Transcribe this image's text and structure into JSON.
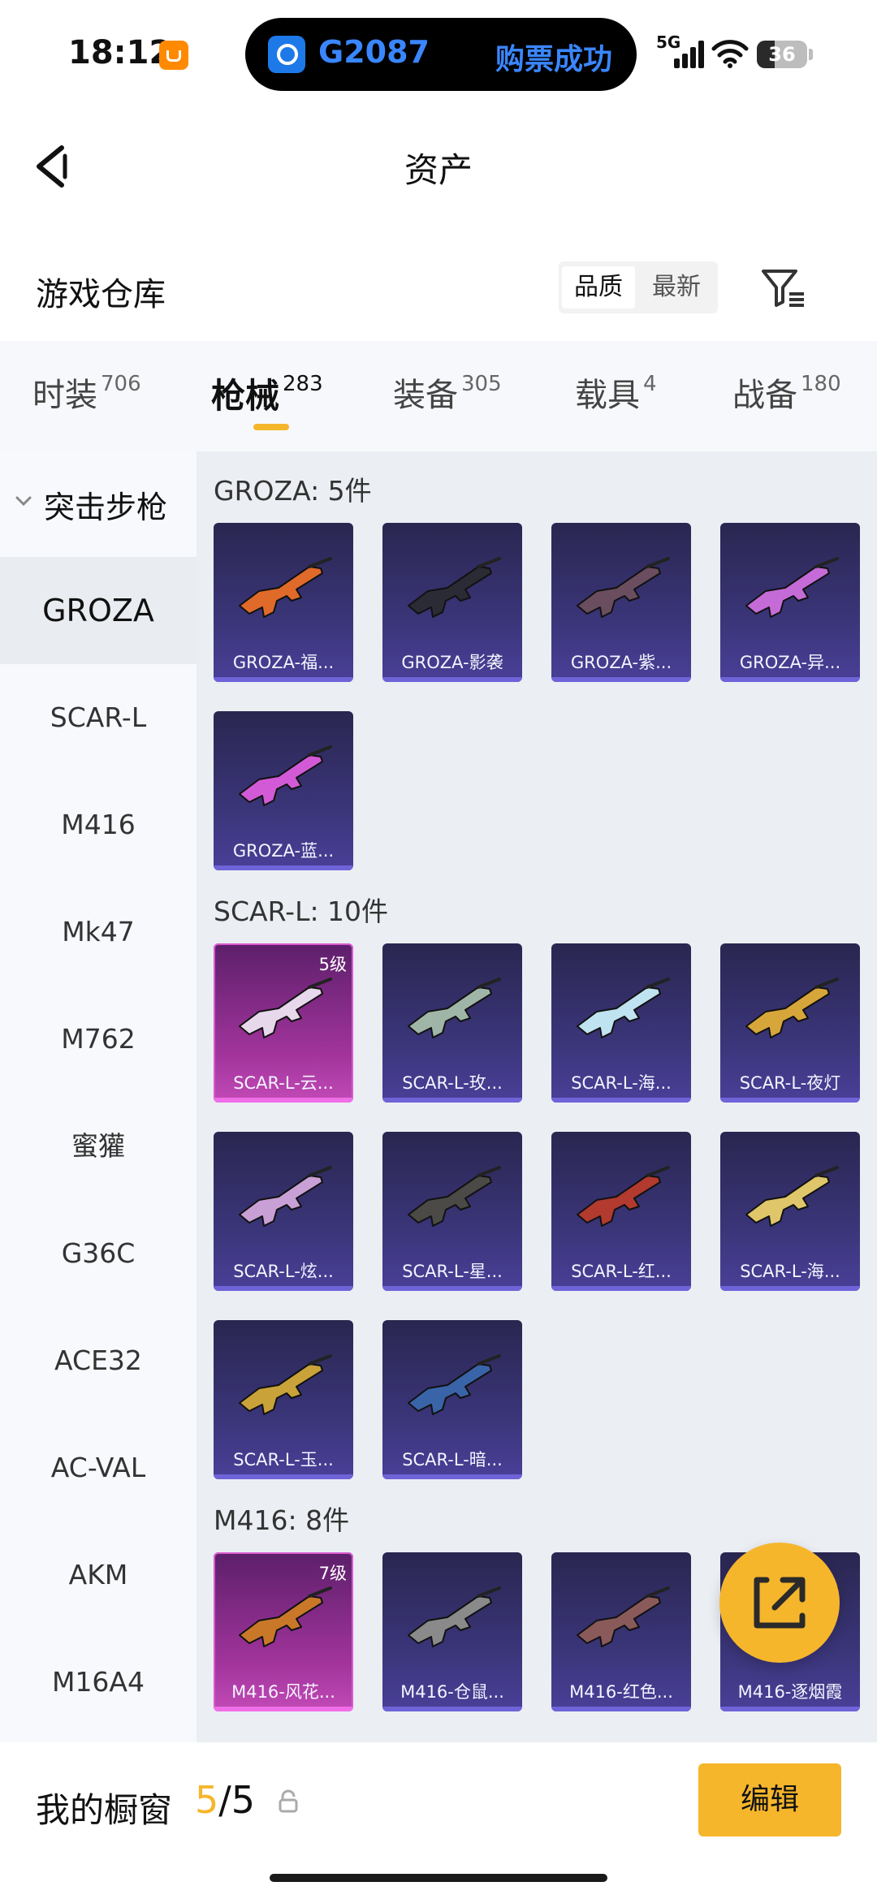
{
  "status_bar": {
    "time": "18:12",
    "train": "G2087",
    "message": "购票成功",
    "network": "5G",
    "battery": "36",
    "battery_level": 0.36
  },
  "header": {
    "title": "资产"
  },
  "warehouse": {
    "title": "游戏仓库",
    "sort_options": [
      "品质",
      "最新"
    ],
    "active_sort": "品质"
  },
  "tabs": [
    {
      "label": "时装",
      "count": "706"
    },
    {
      "label": "枪械",
      "count": "283"
    },
    {
      "label": "装备",
      "count": "305"
    },
    {
      "label": "载具",
      "count": "4"
    },
    {
      "label": "战备",
      "count": "180"
    }
  ],
  "active_tab": "枪械",
  "sidebar": {
    "header": "突击步枪",
    "items": [
      "GROZA",
      "SCAR-L",
      "M416",
      "Mk47",
      "M762",
      "蜜獾",
      "G36C",
      "ACE32",
      "AC-VAL",
      "AKM",
      "M16A4"
    ],
    "active": "GROZA"
  },
  "groups": [
    {
      "title": "GROZA: 5件",
      "items": [
        {
          "name": "GROZA-福...",
          "rarity": "purple",
          "accent": "#e06a2a"
        },
        {
          "name": "GROZA-影袭",
          "rarity": "purple",
          "accent": "#2b2b36"
        },
        {
          "name": "GROZA-紫...",
          "rarity": "purple",
          "accent": "#6a4d5e"
        },
        {
          "name": "GROZA-异...",
          "rarity": "purple",
          "accent": "#c56bd8"
        },
        {
          "name": "GROZA-蓝...",
          "rarity": "purple",
          "accent": "#d35ad6"
        }
      ]
    },
    {
      "title": "SCAR-L: 10件",
      "items": [
        {
          "name": "SCAR-L-云...",
          "rarity": "pink",
          "grade": "5级",
          "accent": "#e8d8ec"
        },
        {
          "name": "SCAR-L-玫...",
          "rarity": "purple",
          "accent": "#9fb5a8"
        },
        {
          "name": "SCAR-L-海...",
          "rarity": "purple",
          "accent": "#bfe3f0"
        },
        {
          "name": "SCAR-L-夜灯",
          "rarity": "purple",
          "accent": "#d7a63a"
        },
        {
          "name": "SCAR-L-炫...",
          "rarity": "purple",
          "accent": "#c9a0d6"
        },
        {
          "name": "SCAR-L-星...",
          "rarity": "purple",
          "accent": "#4b4a46"
        },
        {
          "name": "SCAR-L-红...",
          "rarity": "purple",
          "accent": "#b23a2e"
        },
        {
          "name": "SCAR-L-海...",
          "rarity": "purple",
          "accent": "#e0c66a"
        },
        {
          "name": "SCAR-L-玉...",
          "rarity": "purple",
          "accent": "#c9a23a"
        },
        {
          "name": "SCAR-L-暗...",
          "rarity": "purple",
          "accent": "#3a64a8"
        }
      ]
    },
    {
      "title": "M416: 8件",
      "items": [
        {
          "name": "M416-风花...",
          "rarity": "pink",
          "grade": "7级",
          "accent": "#c9782a"
        },
        {
          "name": "M416-仓鼠...",
          "rarity": "purple",
          "accent": "#8a8a8a"
        },
        {
          "name": "M416-红色...",
          "rarity": "purple",
          "accent": "#8a5a5a"
        },
        {
          "name": "M416-逐烟霞",
          "rarity": "purple",
          "accent": "#7a6a8a"
        }
      ]
    }
  ],
  "showcase": {
    "label": "我的橱窗",
    "current": "5",
    "separator": "/",
    "total": "5",
    "edit_label": "编辑"
  },
  "colors": {
    "accent": "#f5b62c",
    "card_purple": "#3a3578",
    "card_pink": "#a2349c"
  },
  "icons": {
    "back": "chevron-left-icon",
    "filter": "filter-icon",
    "share": "share-out-icon",
    "lock": "lock-icon"
  }
}
